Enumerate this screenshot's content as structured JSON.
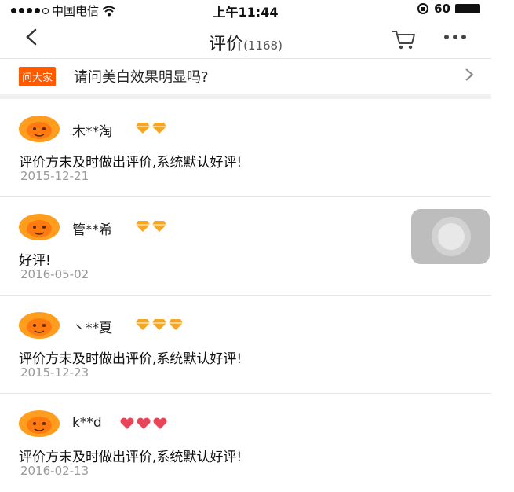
{
  "status_bar": {
    "carrier": "中国电信",
    "time": "上午11:44",
    "battery": "60"
  },
  "nav": {
    "title": "评价",
    "count": "(1168)"
  },
  "ask": {
    "tag": "问大家",
    "question": "请问美白效果明显吗?"
  },
  "reviews": [
    {
      "user": "木**淘",
      "level_count": 2,
      "level_type": "diamond",
      "content": "评价方未及时做出评价,系统默认好评!",
      "date": "2015-12-21"
    },
    {
      "user": "管**希",
      "level_count": 2,
      "level_type": "diamond",
      "content": "好评!",
      "date": "2016-05-02"
    },
    {
      "user": "丶**夏",
      "level_count": 3,
      "level_type": "diamond",
      "content": "评价方未及时做出评价,系统默认好评!",
      "date": "2015-12-23"
    },
    {
      "user": "k**d",
      "level_count": 3,
      "level_type": "heart",
      "content": "评价方未及时做出评价,系统默认好评!",
      "date": "2016-02-13"
    }
  ],
  "colors": {
    "accent": "#ff5a00",
    "diamond": "#f5a623",
    "heart": "#e8455a",
    "date_text": "#999999"
  }
}
